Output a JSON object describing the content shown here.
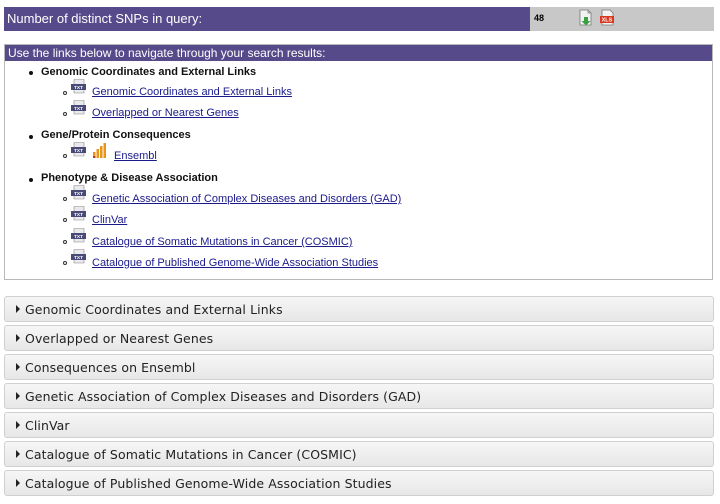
{
  "summary": {
    "label": "Number of distinct SNPs in query:",
    "count": "48",
    "downloads": [
      {
        "name": "download-txt-icon"
      },
      {
        "name": "download-xls-icon",
        "text": "XLS"
      }
    ]
  },
  "nav": {
    "header": "Use the links below to navigate through your search results:",
    "icon_text": "TXT",
    "sections": [
      {
        "title": "Genomic Coordinates and External Links",
        "links": [
          "Genomic Coordinates and External Links",
          "Overlapped or Nearest Genes"
        ]
      },
      {
        "title": "Gene/Protein Consequences",
        "links": [
          "Ensembl"
        ]
      },
      {
        "title": "Phenotype & Disease Association",
        "links": [
          "Genetic Association of Complex Diseases and Disorders (GAD)",
          "ClinVar",
          "Catalogue of Somatic Mutations in Cancer (COSMIC)",
          "Catalogue of Published Genome-Wide Association Studies"
        ]
      }
    ]
  },
  "accordion": [
    "Genomic Coordinates and External Links",
    "Overlapped or Nearest Genes",
    "Consequences on Ensembl",
    "Genetic Association of Complex Diseases and Disorders (GAD)",
    "ClinVar",
    "Catalogue of Somatic Mutations in Cancer (COSMIC)",
    "Catalogue of Published Genome-Wide Association Studies"
  ],
  "colors": {
    "header_purple": "#564a8a",
    "link_blue": "#1a1a8c",
    "bars_orange": "#e8951a"
  }
}
